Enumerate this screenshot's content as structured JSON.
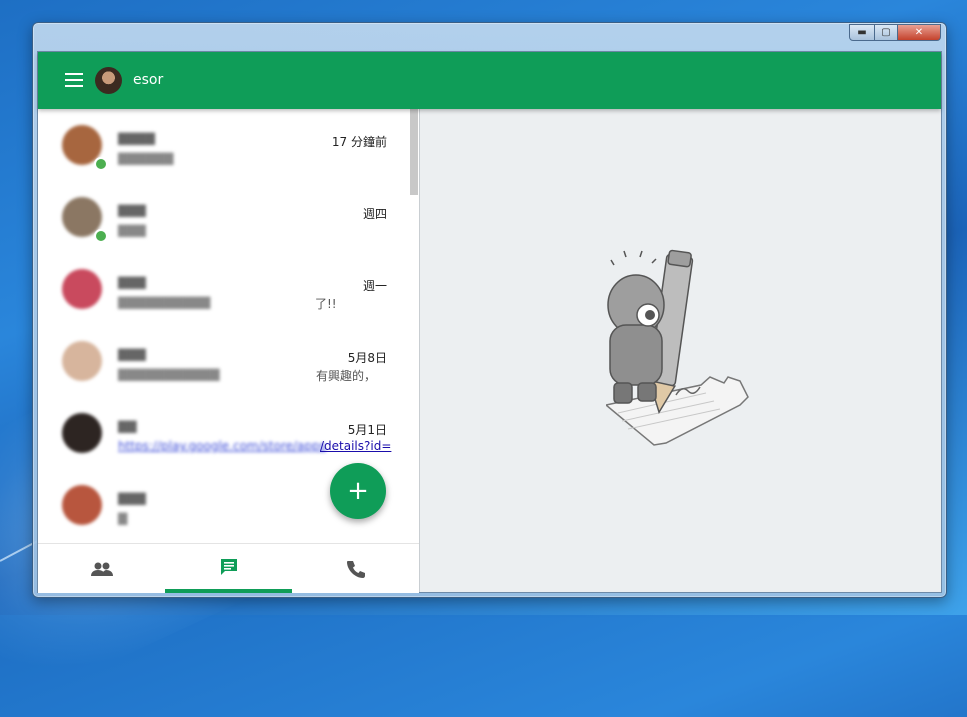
{
  "window": {
    "controls": {
      "minimize": "▬",
      "maximize": "▢",
      "close": "✕"
    }
  },
  "header": {
    "username": "esor"
  },
  "conversations": [
    {
      "name": "▇▇▇▇",
      "snippet": "▇▇▇▇▇▇",
      "tail": "",
      "time": "17 分鐘前",
      "online": true,
      "avatar_color": "#a7663f"
    },
    {
      "name": "▇▇▇",
      "snippet": "▇▇▇",
      "tail": "",
      "time": "週四",
      "online": true,
      "avatar_color": "#8b7763"
    },
    {
      "name": "▇▇▇",
      "snippet": "▇▇▇▇▇▇▇▇▇▇",
      "tail": "了!!",
      "time": "週一",
      "online": false,
      "avatar_color": "#c94a5e"
    },
    {
      "name": "▇▇▇",
      "snippet": "▇▇▇▇▇▇▇▇▇▇▇",
      "tail": "有興趣的，",
      "time": "5月8日",
      "online": false,
      "avatar_color": "#d7b59d"
    },
    {
      "name": "▇▇",
      "snippet": "https://play.google.com/store/apps",
      "tail": "/details?id=",
      "time": "5月1日",
      "online": false,
      "avatar_color": "#2d2522",
      "link": true
    },
    {
      "name": "▇▇▇",
      "snippet": "▇",
      "tail": "",
      "time": "",
      "online": false,
      "avatar_color": "#b8563e"
    }
  ],
  "fab": {
    "label": "+"
  },
  "bottom_nav": {
    "tabs": [
      {
        "id": "contacts",
        "icon": "people-icon"
      },
      {
        "id": "messages",
        "icon": "chat-icon",
        "active": true
      },
      {
        "id": "calls",
        "icon": "phone-icon"
      }
    ]
  },
  "colors": {
    "accent": "#0f9d58",
    "pane_bg": "#eceff1"
  }
}
